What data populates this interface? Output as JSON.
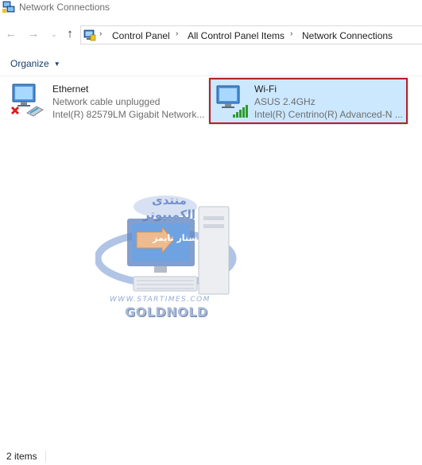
{
  "window": {
    "title": "Network Connections",
    "app_icon": "network-connections-icon"
  },
  "nav": {
    "back_icon": "arrow-left-icon",
    "forward_icon": "arrow-right-icon",
    "recent_icon": "chevron-down-icon",
    "up_icon": "arrow-up-icon",
    "breadcrumb": [
      "Control Panel",
      "All Control Panel Items",
      "Network Connections"
    ]
  },
  "toolbar": {
    "organize_label": "Organize"
  },
  "connections": [
    {
      "name": "Ethernet",
      "status": "Network cable unplugged",
      "device": "Intel(R) 82579LM Gigabit Network...",
      "icon": "ethernet-adapter-disconnected-icon",
      "selected": false
    },
    {
      "name": "Wi-Fi",
      "status": "ASUS 2.4GHz",
      "device": "Intel(R) Centrino(R) Advanced-N ...",
      "icon": "wifi-adapter-connected-icon",
      "selected": true
    }
  ],
  "watermark": {
    "arabic_title": "منتدى الكمبيوتر",
    "arabic_sub": "ستار تايمز",
    "url": "WWW.STARTIMES.COM",
    "name": "GOLDNOLD"
  },
  "statusbar": {
    "item_count": "2 items"
  },
  "colors": {
    "selection_bg": "#cce8ff",
    "highlight_border": "#b52027",
    "link_blue": "#1a3e6e",
    "signal_green": "#2e9b2e"
  }
}
